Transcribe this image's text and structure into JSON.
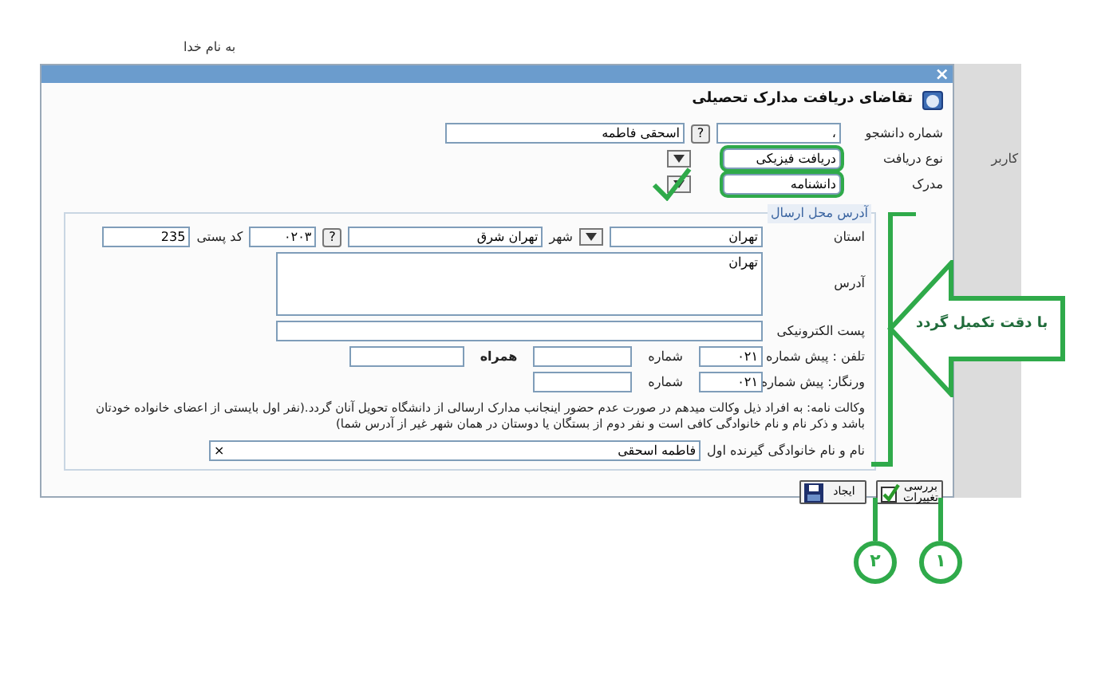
{
  "background_text": "به نام خدا",
  "side_panel": {
    "label": "کاربر"
  },
  "dialog": {
    "close": "×",
    "title": "تقاضای دریافت مدارک تحصیلی"
  },
  "student": {
    "label": "شماره دانشجو",
    "number": "،",
    "lookup": "?",
    "name": "اسحقی فاطمه"
  },
  "receipt_type": {
    "label": "نوع دریافت",
    "value": "دریافت فیزیکی"
  },
  "document": {
    "label": "مدرک",
    "value": "دانشنامه"
  },
  "address_section": {
    "legend": "آدرس محل ارسال",
    "province_label": "استان",
    "province": "تهران",
    "city_label": "شهر",
    "city": "تهران شرق",
    "lookup": "?",
    "city_code": "۰۲۰۳",
    "postal_label": "کد پستی",
    "postal_code": "235",
    "address_label": "آدرس",
    "address": "تهران",
    "email_label": "پست الکترونیکی",
    "phone_label": "تلفن : پیش شماره",
    "phone_prefix": "۰۲۱",
    "phone_number_label": "شماره",
    "mobile_label": "همراه",
    "fax_label": "ورنگار: پیش شماره",
    "fax_prefix": "۰۲۱",
    "fax_number_label": "شماره",
    "power_of_attorney": "وکالت نامه: به افراد ذیل وکالت میدهم در صورت عدم حضور اینجانب مدارک ارسالی از دانشگاه تحویل آنان گردد.(نفر اول بایستی از اعضای خانواده خودتان باشد و ذکر نام و نام خانوادگی کافی است و نفر دوم از بستگان یا دوستان در همان شهر غیر از آدرس شما)",
    "recipient_label": "نام و نام خانوادگی گیرنده اول",
    "recipient": "فاطمه اسحقی",
    "clear": "×"
  },
  "buttons": [
    {
      "kind": "check",
      "label": "بررسی تغییرات"
    },
    {
      "kind": "save",
      "label": "ایجاد"
    }
  ],
  "annotation": {
    "callout": "با دقت تکمیل گردد",
    "steps": [
      "۱",
      "۲"
    ]
  }
}
